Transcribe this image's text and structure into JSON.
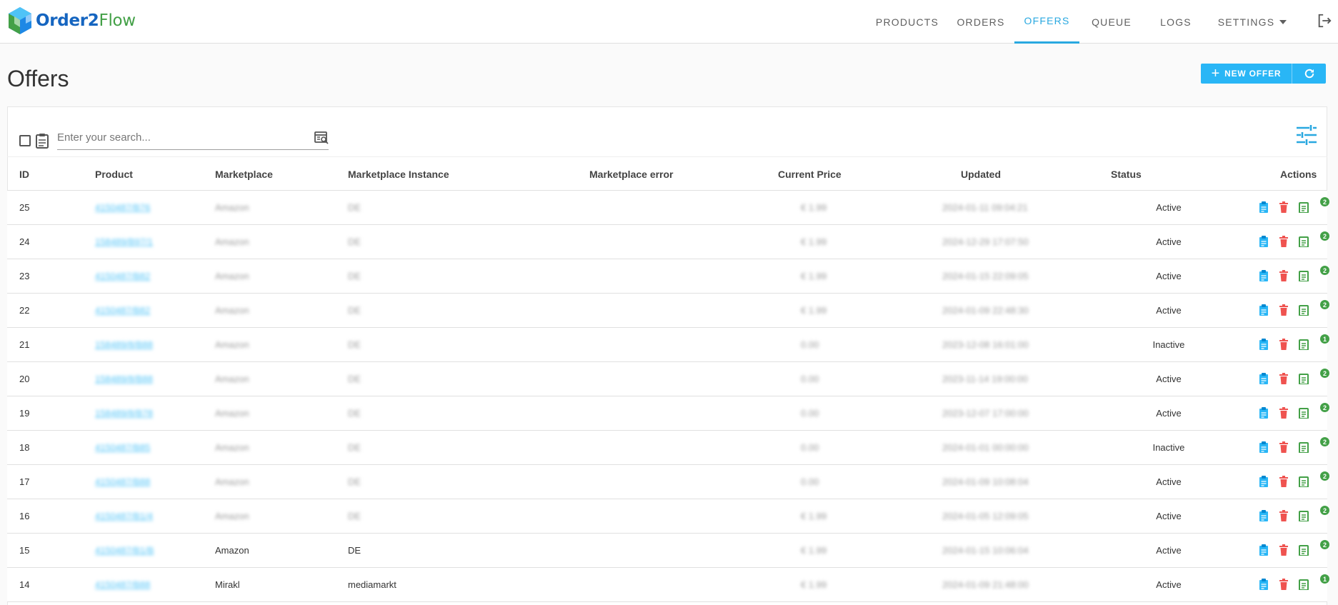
{
  "app": {
    "logo_part1": "Order2",
    "logo_part2": "Flow"
  },
  "nav": {
    "products": "PRODUCTS",
    "orders": "ORDERS",
    "offers": "OFFERS",
    "queue": "QUEUE",
    "logs": "LOGS",
    "settings": "SETTINGS"
  },
  "page": {
    "title": "Offers",
    "new_offer_label": "NEW OFFER"
  },
  "search": {
    "placeholder": "Enter your search..."
  },
  "table": {
    "headers": {
      "id": "ID",
      "product": "Product",
      "marketplace": "Marketplace",
      "instance": "Marketplace Instance",
      "error": "Marketplace error",
      "price": "Current Price",
      "updated": "Updated",
      "status": "Status",
      "actions": "Actions"
    },
    "rows": [
      {
        "id": "25",
        "product": "4150487/B76",
        "marketplace": "Amazon",
        "instance": "DE",
        "price": "€ 1.99",
        "updated": "2024-01-11 09:04:21",
        "status": "Active",
        "badge": "2"
      },
      {
        "id": "24",
        "product": "158489/B97/1",
        "marketplace": "Amazon",
        "instance": "DE",
        "price": "€ 1.99",
        "updated": "2024-12-29 17:07:50",
        "status": "Active",
        "badge": "2"
      },
      {
        "id": "23",
        "product": "4150487/B82",
        "marketplace": "Amazon",
        "instance": "DE",
        "price": "€ 1.99",
        "updated": "2024-01-15 22:09:05",
        "status": "Active",
        "badge": "2"
      },
      {
        "id": "22",
        "product": "4150487/B82",
        "marketplace": "Amazon",
        "instance": "DE",
        "price": "€ 1.99",
        "updated": "2024-01-09 22:48:30",
        "status": "Active",
        "badge": "2"
      },
      {
        "id": "21",
        "product": "158489/8/B88",
        "marketplace": "Amazon",
        "instance": "DE",
        "price": "0.00",
        "updated": "2023-12-08 16:01:00",
        "status": "Inactive",
        "badge": "1"
      },
      {
        "id": "20",
        "product": "158489/8/B88",
        "marketplace": "Amazon",
        "instance": "DE",
        "price": "0.00",
        "updated": "2023-11-14 19:00:00",
        "status": "Active",
        "badge": "2"
      },
      {
        "id": "19",
        "product": "158489/8/B78",
        "marketplace": "Amazon",
        "instance": "DE",
        "price": "0.00",
        "updated": "2023-12-07 17:00:00",
        "status": "Active",
        "badge": "2"
      },
      {
        "id": "18",
        "product": "4150487/B85",
        "marketplace": "Amazon",
        "instance": "DE",
        "price": "0.00",
        "updated": "2024-01-01 00:00:00",
        "status": "Inactive",
        "badge": "2"
      },
      {
        "id": "17",
        "product": "4150487/B88",
        "marketplace": "Amazon",
        "instance": "DE",
        "price": "0.00",
        "updated": "2024-01-09 10:08:04",
        "status": "Active",
        "badge": "2"
      },
      {
        "id": "16",
        "product": "4150487/B1/4",
        "marketplace": "Amazon",
        "instance": "DE",
        "price": "€ 1.99",
        "updated": "2024-01-05 12:09:05",
        "status": "Active",
        "badge": "2"
      },
      {
        "id": "15",
        "product": "4150487/B1/B",
        "marketplace": "Amazon",
        "instance": "DE",
        "price": "€ 1.99",
        "updated": "2024-01-15 10:06:04",
        "status": "Active",
        "badge": "2"
      },
      {
        "id": "14",
        "product": "4150487/B88",
        "marketplace": "Mirakl",
        "instance": "mediamarkt",
        "price": "€ 1.99",
        "updated": "2024-01-09 21:48:00",
        "status": "Active",
        "badge": "1"
      }
    ]
  },
  "colors": {
    "accent": "#29b6f6",
    "nav_active": "#29a8e0",
    "delete": "#ef5350",
    "badge": "#43a047"
  },
  "icons": [
    "logout-icon",
    "clipboard-icon",
    "search-list-icon",
    "tune-icon",
    "refresh-icon",
    "edit-icon",
    "delete-icon",
    "offer-history-icon"
  ]
}
